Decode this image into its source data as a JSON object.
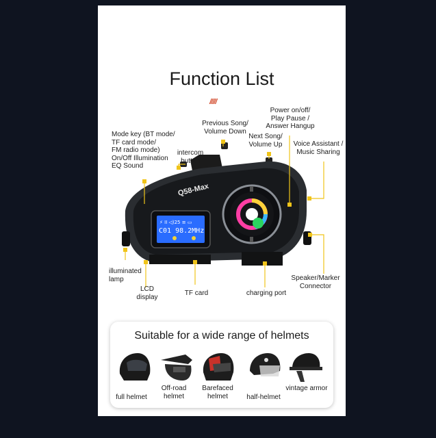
{
  "title": "Function List",
  "accent_color": "#d24a2c",
  "device": {
    "model": "Q58-Max",
    "lcd_line1": "⚡ II ◁)25 ≡ ▭",
    "lcd_line2": "C01 98.2MHz"
  },
  "labels": {
    "mode_key": "Mode key (BT mode/\nTF card mode/\nFM radio mode)\nOn/Off Illumination\nEQ Sound",
    "intercom": "intercom\nbutton",
    "prev_song": "Previous Song/\nVolume Down",
    "next_song": "Next Song/\nVolume Up",
    "power": "Power on/off/\nPlay Pause /\nAnswer Hangup",
    "voice": "Voice Assistant /\nMusic Sharing",
    "lamp": "illuminated\nlamp",
    "lcd": "LCD\ndisplay",
    "tf_card": "TF card",
    "charging": "charging port",
    "speaker": "Speaker/Marker\nConnector"
  },
  "helmets": {
    "title": "Suitable for a wide range of helmets",
    "items": [
      {
        "label": "full helmet"
      },
      {
        "label": "Off-road\nhelmet"
      },
      {
        "label": "Barefaced\nhelmet"
      },
      {
        "label": "half-helmet"
      },
      {
        "label": "vintage\narmor"
      }
    ]
  }
}
